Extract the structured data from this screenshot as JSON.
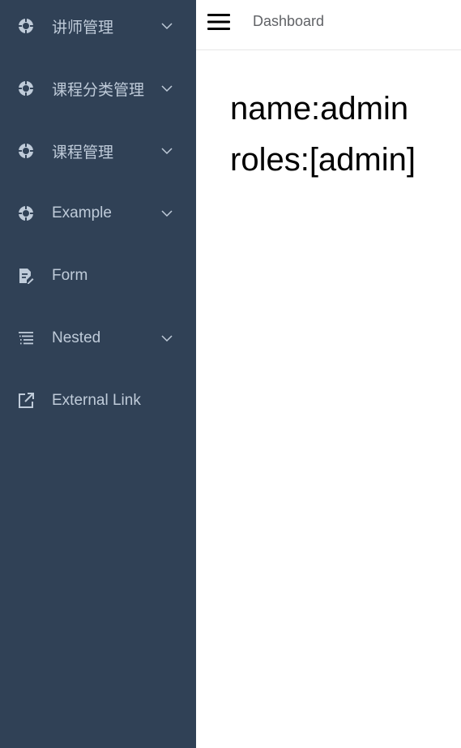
{
  "sidebar": {
    "background": "#304156",
    "text_color": "#bfcbd9",
    "items": [
      {
        "label": "讲师管理",
        "icon": "circle-target-icon",
        "has_children": true
      },
      {
        "label": "课程分类管理",
        "icon": "circle-target-icon",
        "has_children": true
      },
      {
        "label": "课程管理",
        "icon": "circle-target-icon",
        "has_children": true
      },
      {
        "label": "Example",
        "icon": "circle-target-icon",
        "has_children": true
      },
      {
        "label": "Form",
        "icon": "form-icon",
        "has_children": false
      },
      {
        "label": "Nested",
        "icon": "nested-list-icon",
        "has_children": true
      },
      {
        "label": "External Link",
        "icon": "external-link-icon",
        "has_children": false
      }
    ]
  },
  "navbar": {
    "breadcrumb": "Dashboard",
    "toggle_icon": "hamburger-icon"
  },
  "dashboard": {
    "name_line": "name:admin",
    "roles_line": "roles:[admin]"
  }
}
